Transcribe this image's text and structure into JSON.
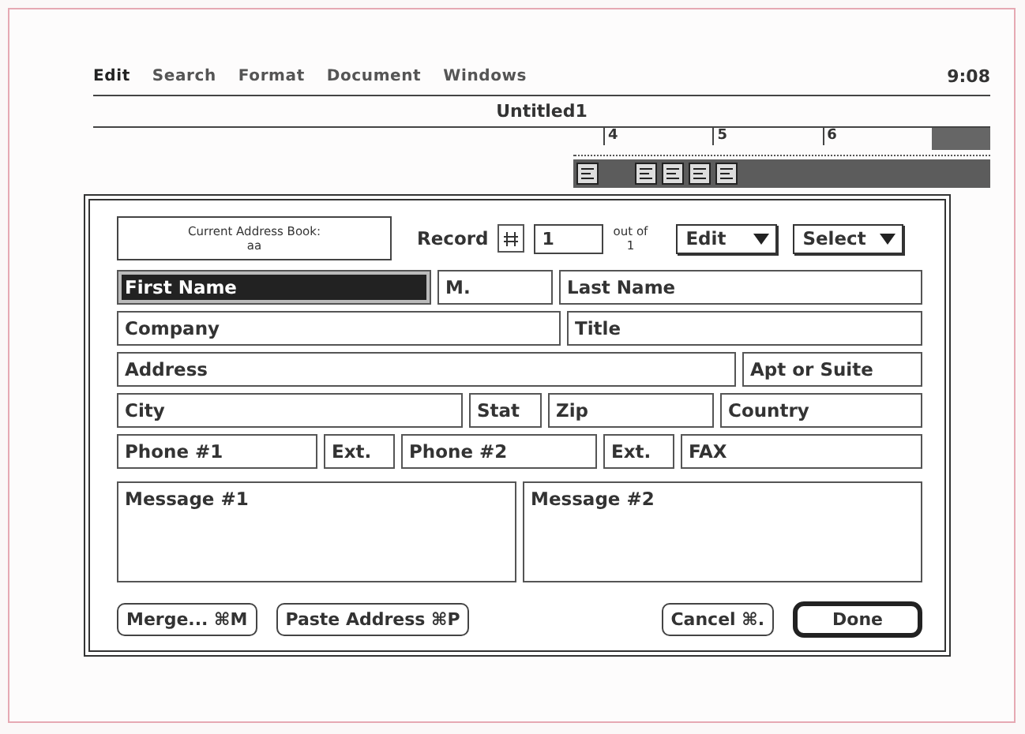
{
  "menu_bar": {
    "items": [
      "Edit",
      "Search",
      "Format",
      "Document",
      "Windows"
    ],
    "clock": "9:08"
  },
  "document": {
    "title": "Untitled1",
    "ruler_labels": [
      "4",
      "5",
      "6"
    ]
  },
  "dialog": {
    "address_book": {
      "label": "Current Address Book:",
      "name": "aa"
    },
    "record": {
      "label": "Record",
      "value": "1",
      "out_of_label": "out of",
      "total": "1"
    },
    "menus": [
      "Edit",
      "Select"
    ],
    "field_rows": [
      [
        {
          "text": "First Name",
          "selected": true
        },
        {
          "text": "M.",
          "selected": false
        },
        {
          "text": "Last Name",
          "selected": false
        }
      ],
      [
        {
          "text": "Company",
          "selected": false
        },
        {
          "text": "Title",
          "selected": false
        }
      ],
      [
        {
          "text": "Address",
          "selected": false
        },
        {
          "text": "Apt or Suite",
          "selected": false
        }
      ],
      [
        {
          "text": "City",
          "selected": false
        },
        {
          "text": "Stat",
          "selected": false
        },
        {
          "text": "Zip",
          "selected": false
        },
        {
          "text": "Country",
          "selected": false
        }
      ],
      [
        {
          "text": "Phone #1",
          "selected": false
        },
        {
          "text": "Ext.",
          "selected": false
        },
        {
          "text": "Phone #2",
          "selected": false
        },
        {
          "text": "Ext.",
          "selected": false
        },
        {
          "text": "FAX",
          "selected": false
        }
      ]
    ],
    "messages": [
      "Message #1",
      "Message #2"
    ],
    "buttons": [
      {
        "label": "Merge... ⌘M",
        "default": false
      },
      {
        "label": "Paste Address ⌘P",
        "default": false
      },
      {
        "label": "Cancel ⌘.",
        "default": false
      },
      {
        "label": "Done",
        "default": true
      }
    ]
  }
}
